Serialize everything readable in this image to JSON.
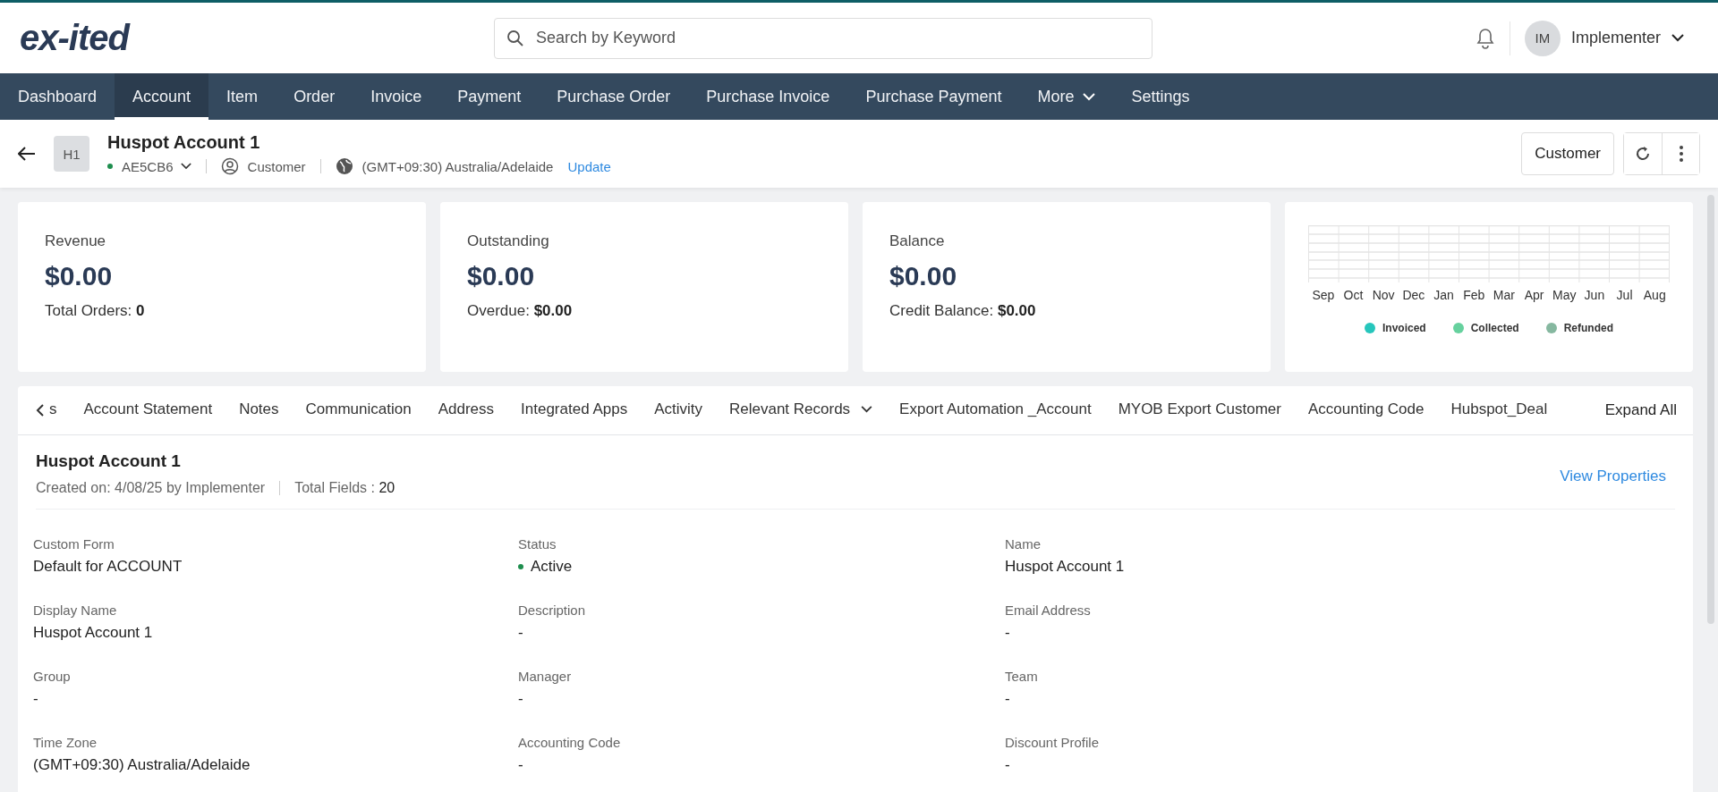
{
  "header": {
    "logo": "ex-ited",
    "search": {
      "placeholder": "Search by Keyword"
    },
    "user": {
      "initials": "IM",
      "name": "Implementer"
    }
  },
  "nav": [
    {
      "label": "Dashboard",
      "selected": false,
      "kind": "link"
    },
    {
      "label": "Account",
      "selected": true,
      "kind": "link"
    },
    {
      "label": "Item",
      "selected": false,
      "kind": "link"
    },
    {
      "label": "Order",
      "selected": false,
      "kind": "link"
    },
    {
      "label": "Invoice",
      "selected": false,
      "kind": "link"
    },
    {
      "label": "Payment",
      "selected": false,
      "kind": "link"
    },
    {
      "label": "Purchase Order",
      "selected": false,
      "kind": "link"
    },
    {
      "label": "Purchase Invoice",
      "selected": false,
      "kind": "link"
    },
    {
      "label": "Purchase Payment",
      "selected": false,
      "kind": "link"
    },
    {
      "label": "More",
      "selected": false,
      "kind": "menu"
    },
    {
      "label": "Settings",
      "selected": false,
      "kind": "link"
    }
  ],
  "record": {
    "badge": "H1",
    "title": "Huspot Account 1",
    "code": "AE5CB6",
    "active": true,
    "type": "Customer",
    "timezone": "(GMT+09:30) Australia/Adelaide",
    "update_link": "Update",
    "type_button": "Customer"
  },
  "cards": [
    {
      "label": "Revenue",
      "amount": "$0.00",
      "sub_label": "Total Orders:",
      "sub_value": "0"
    },
    {
      "label": "Outstanding",
      "amount": "$0.00",
      "sub_label": "Overdue:",
      "sub_value": "$0.00"
    },
    {
      "label": "Balance",
      "amount": "$0.00",
      "sub_label": "Credit Balance:",
      "sub_value": "$0.00"
    }
  ],
  "chart": {
    "months": [
      "Sep",
      "Oct",
      "Nov",
      "Dec",
      "Jan",
      "Feb",
      "Mar",
      "Apr",
      "May",
      "Jun",
      "Jul",
      "Aug"
    ],
    "legend": [
      {
        "label": "Invoiced",
        "color": "#26c6bc"
      },
      {
        "label": "Collected",
        "color": "#66d19e"
      },
      {
        "label": "Refunded",
        "color": "#86b8a0"
      }
    ]
  },
  "tabs": [
    {
      "label": "s",
      "selected": false,
      "kind": "tab"
    },
    {
      "label": "Account Statement",
      "selected": false,
      "kind": "tab"
    },
    {
      "label": "Notes",
      "selected": false,
      "kind": "tab"
    },
    {
      "label": "Communication",
      "selected": false,
      "kind": "tab"
    },
    {
      "label": "Address",
      "selected": false,
      "kind": "tab"
    },
    {
      "label": "Integrated Apps",
      "selected": false,
      "kind": "tab"
    },
    {
      "label": "Activity",
      "selected": false,
      "kind": "tab"
    },
    {
      "label": "Relevant Records",
      "selected": false,
      "kind": "menu"
    },
    {
      "label": "Export Automation _Account",
      "selected": false,
      "kind": "tab"
    },
    {
      "label": "MYOB Export Customer",
      "selected": false,
      "kind": "tab"
    },
    {
      "label": "Accounting Code",
      "selected": false,
      "kind": "tab"
    },
    {
      "label": "Hubspot_Deal",
      "selected": false,
      "kind": "tab"
    }
  ],
  "expand_all": "Expand All",
  "details": {
    "title": "Huspot Account 1",
    "created": "Created on: 4/08/25 by Implementer",
    "total_label": "Total Fields :",
    "total_value": "20",
    "view_properties": "View Properties",
    "fields": [
      {
        "label": "Custom Form",
        "value": "Default for ACCOUNT",
        "kind": "text"
      },
      {
        "label": "Status",
        "value": "Active",
        "kind": "status",
        "color": "#1e8e4e"
      },
      {
        "label": "Name",
        "value": "Huspot Account 1",
        "kind": "text"
      },
      {
        "label": "Display Name",
        "value": "Huspot Account 1",
        "kind": "text"
      },
      {
        "label": "Description",
        "value": "-",
        "kind": "text"
      },
      {
        "label": "Email Address",
        "value": "-",
        "kind": "text"
      },
      {
        "label": "Group",
        "value": "-",
        "kind": "text"
      },
      {
        "label": "Manager",
        "value": "-",
        "kind": "text"
      },
      {
        "label": "Team",
        "value": "-",
        "kind": "text"
      },
      {
        "label": "Time Zone",
        "value": "(GMT+09:30) Australia/Adelaide",
        "kind": "text"
      },
      {
        "label": "Accounting Code",
        "value": "-",
        "kind": "text"
      },
      {
        "label": "Discount Profile",
        "value": "-",
        "kind": "text"
      }
    ]
  }
}
